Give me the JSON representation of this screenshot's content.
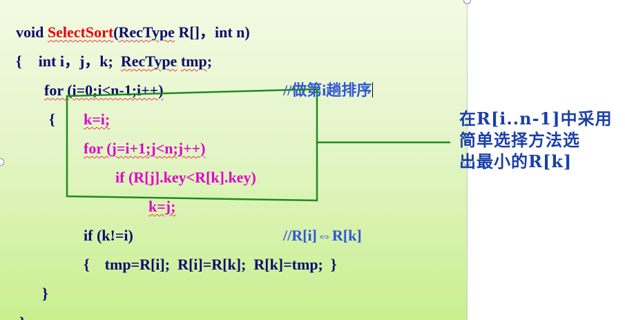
{
  "code": {
    "line1": {
      "prefix": "void ",
      "func": "SelectSort",
      "paren_open": "(",
      "rectype": "RecType",
      "rest": " R[]，int n)"
    },
    "line2": {
      "brace": "{",
      "decl": "int i，j，k;",
      "rectype": "RecType",
      "tmp": "tmp",
      "end": ";"
    },
    "line3": {
      "code": "for (i=0;i<n-1;i++)",
      "comment": "//做第i趟排序"
    },
    "line4": {
      "brace": "{",
      "code": "k=i;"
    },
    "line5": {
      "code": "for (j=i+1;j<n;j++)"
    },
    "line6": {
      "code": "if (R[j].key<R[k].key)"
    },
    "line7": {
      "code": "k=j;"
    },
    "line8": {
      "code": "if (k!=i)",
      "comment": "//R[i]⇔R[k]"
    },
    "line9": {
      "code": "{    tmp=R[i];  R[i]=R[k];  R[k]=tmp;  }"
    },
    "line10": {
      "brace": "}"
    },
    "line11": {
      "brace": "}"
    }
  },
  "annotation": {
    "line1": "在R[i..n-1]中采用",
    "line2": "简单选择方法选",
    "line3": "出最小的R[k]"
  },
  "colors": {
    "code": "#0a0a6e",
    "highlight": "#e000c8",
    "function_name": "#e8000e",
    "comment": "#2f55d8",
    "box": "#1f8a1f",
    "annotation": "#1a3fa8"
  }
}
